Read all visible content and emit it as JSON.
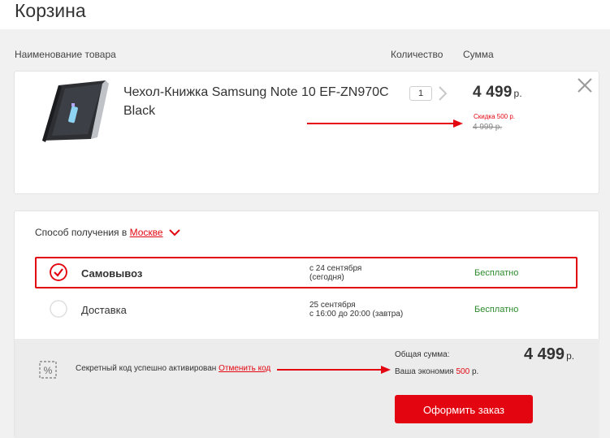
{
  "page": {
    "title": "Корзина"
  },
  "columns": {
    "name": "Наименование товара",
    "quantity": "Количество",
    "sum": "Сумма"
  },
  "product": {
    "name": "Чехол-Книжка Samsung Note 10 EF-ZN970C Black",
    "quantity": "1",
    "price": "4 499",
    "currency": "р.",
    "discount": "Скидка 500 р.",
    "old_price": "4 999 р."
  },
  "delivery": {
    "label": "Способ получения в",
    "city": "Москве",
    "options": [
      {
        "name": "Самовывоз",
        "date_line1": "с 24 сентября",
        "date_line2": "(сегодня)",
        "price": "Бесплатно",
        "selected": true
      },
      {
        "name": "Доставка",
        "date_line1": "25 сентября",
        "date_line2": "с 16:00 до 20:00 (завтра)",
        "price": "Бесплатно",
        "selected": false
      }
    ]
  },
  "summary": {
    "promo_text": "Секретный код успешно активирован",
    "cancel_code": "Отменить код",
    "total_label": "Общая сумма:",
    "total_value": "4 499",
    "currency": "р.",
    "economy_label": "Ваша экономия",
    "economy_amount": "500",
    "economy_currency": "р.",
    "checkout": "Оформить заказ"
  },
  "colors": {
    "accent": "#e30611",
    "free": "#2b8a2b",
    "annotation": "#e30611"
  }
}
